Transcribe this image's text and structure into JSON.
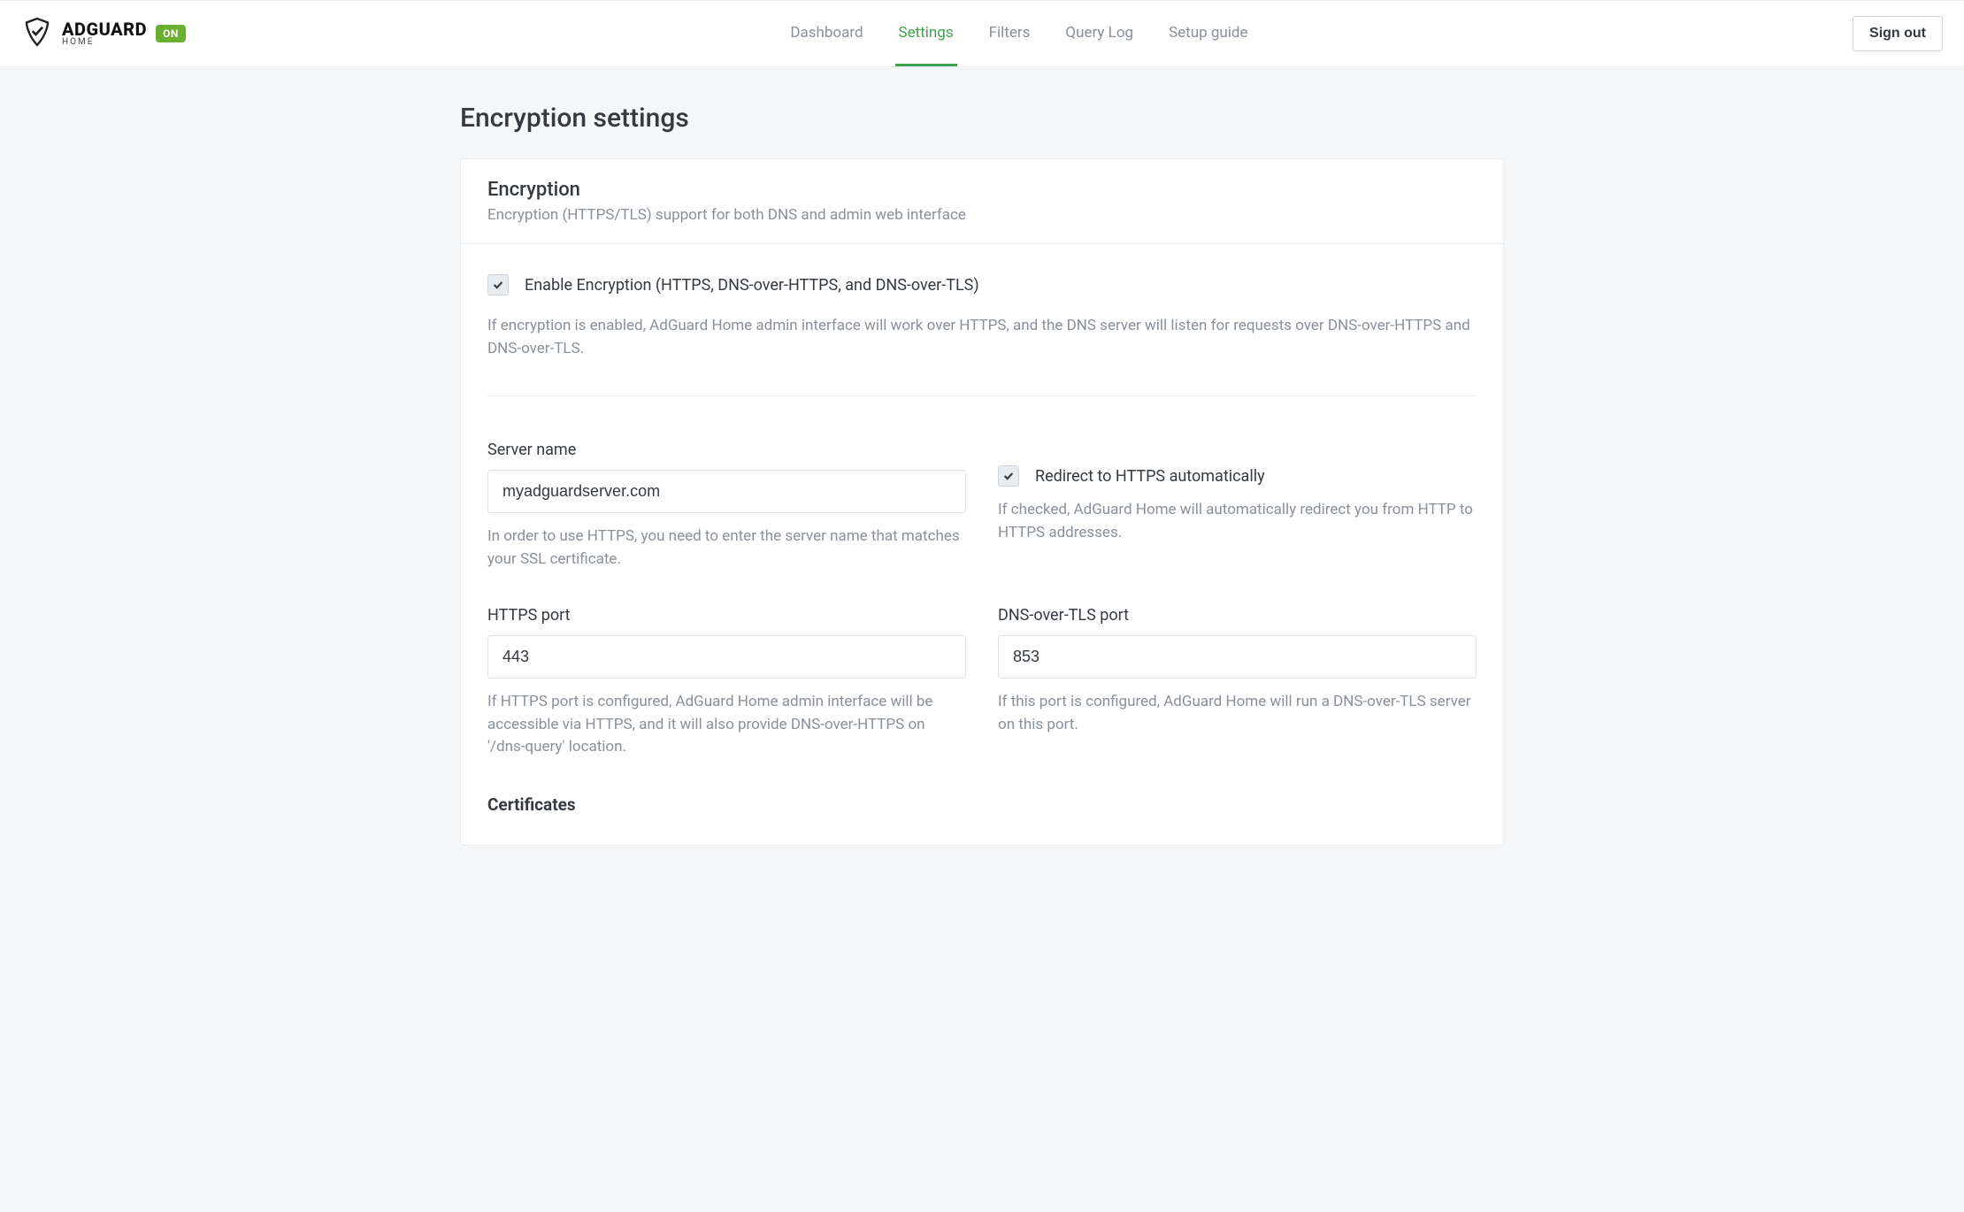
{
  "brand": {
    "main": "ADGUARD",
    "sub": "HOME",
    "status": "ON"
  },
  "nav": {
    "items": [
      {
        "label": "Dashboard",
        "active": false
      },
      {
        "label": "Settings",
        "active": true
      },
      {
        "label": "Filters",
        "active": false
      },
      {
        "label": "Query Log",
        "active": false
      },
      {
        "label": "Setup guide",
        "active": false
      }
    ],
    "signout": "Sign out"
  },
  "page": {
    "title": "Encryption settings"
  },
  "card": {
    "title": "Encryption",
    "subtitle": "Encryption (HTTPS/TLS) support for both DNS and admin web interface"
  },
  "enable": {
    "label": "Enable Encryption (HTTPS, DNS-over-HTTPS, and DNS-over-TLS)",
    "desc": "If encryption is enabled, AdGuard Home admin interface will work over HTTPS, and the DNS server will listen for requests over DNS-over-HTTPS and DNS-over-TLS.",
    "checked": true
  },
  "server_name": {
    "label": "Server name",
    "value": "myadguardserver.com",
    "desc": "In order to use HTTPS, you need to enter the server name that matches your SSL certificate."
  },
  "redirect": {
    "label": "Redirect to HTTPS automatically",
    "desc": "If checked, AdGuard Home will automatically redirect you from HTTP to HTTPS addresses.",
    "checked": true
  },
  "https_port": {
    "label": "HTTPS port",
    "value": "443",
    "desc": "If HTTPS port is configured, AdGuard Home admin interface will be accessible via HTTPS, and it will also provide DNS-over-HTTPS on '/dns-query' location."
  },
  "dns_tls_port": {
    "label": "DNS-over-TLS port",
    "value": "853",
    "desc": "If this port is configured, AdGuard Home will run a DNS-over-TLS server on this port."
  },
  "certificates": {
    "heading": "Certificates"
  }
}
